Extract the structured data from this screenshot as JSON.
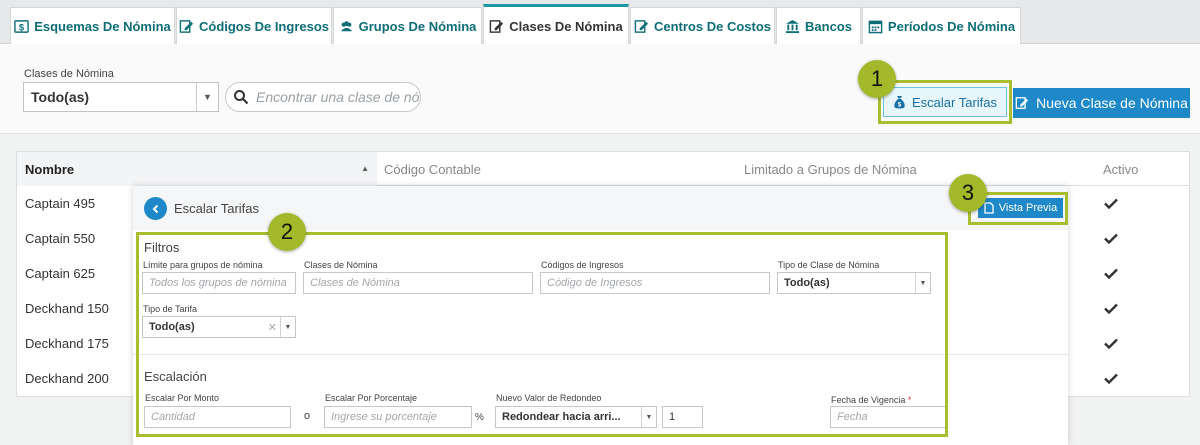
{
  "tabs": [
    {
      "label": "Esquemas De Nómina",
      "icon": "dollar-icon",
      "active": false
    },
    {
      "label": "Códigos De Ingresos",
      "icon": "edit-document-icon",
      "active": false
    },
    {
      "label": "Grupos De Nómina",
      "icon": "users-icon",
      "active": false
    },
    {
      "label": "Clases De Nómina",
      "icon": "edit-document-icon",
      "active": true
    },
    {
      "label": "Centros De Costos",
      "icon": "edit-document-icon",
      "active": false
    },
    {
      "label": "Bancos",
      "icon": "bank-icon",
      "active": false
    },
    {
      "label": "Períodos De Nómina",
      "icon": "calendar-icon",
      "active": false
    }
  ],
  "filter": {
    "label": "Clases de Nómina",
    "selected": "Todo(as)",
    "search_placeholder": "Encontrar una clase de nó"
  },
  "actions": {
    "scale_rates": "Escalar Tarifas",
    "new_class": "Nueva Clase de Nómina"
  },
  "callouts": [
    "1",
    "2",
    "3"
  ],
  "table": {
    "columns": [
      "Nombre",
      "Código Contable",
      "Limitado a Grupos de Nómina",
      "Activo"
    ],
    "rows": [
      {
        "name": "Captain 495",
        "active": true
      },
      {
        "name": "Captain 550",
        "active": true
      },
      {
        "name": "Captain 625",
        "active": true
      },
      {
        "name": "Deckhand 150",
        "active": true
      },
      {
        "name": "Deckhand 175",
        "active": true
      },
      {
        "name": "Deckhand 200",
        "active": true
      }
    ]
  },
  "panel": {
    "title": "Escalar Tarifas",
    "preview": "Vista Previa",
    "filters": {
      "title": "Filtros",
      "group_limit_label": "Límite para grupos de nómina",
      "group_limit_placeholder": "Todos los grupos de nómina",
      "classes_label": "Clases de Nómina",
      "classes_placeholder": "Clases de Nómina",
      "earnings_label": "Códigos de Ingresos",
      "earnings_placeholder": "Código de Ingresos",
      "class_type_label": "Tipo de Clase de Nómina",
      "class_type_value": "Todo(as)",
      "rate_type_label": "Tipo de Tarifa",
      "rate_type_value": "Todo(as)"
    },
    "escalation": {
      "title": "Escalación",
      "amount_label": "Escalar Por Monto",
      "amount_placeholder": "Cantidad",
      "or_text": "o",
      "percent_label": "Escalar Por Porcentaje",
      "percent_placeholder": "Ingrese su porcentaje",
      "percent_symbol": "%",
      "rounding_label": "Nuevo Valor de Redondeo",
      "rounding_value": "Redondear hacia arri...",
      "rounding_amount": "1",
      "effective_label": "Fecha de Vigencia",
      "required_mark": "*",
      "effective_placeholder": "Fecha"
    }
  },
  "colors": {
    "accent": "#1e88c9",
    "tab_text": "#0d6e78",
    "callout": "#a3b92a"
  }
}
